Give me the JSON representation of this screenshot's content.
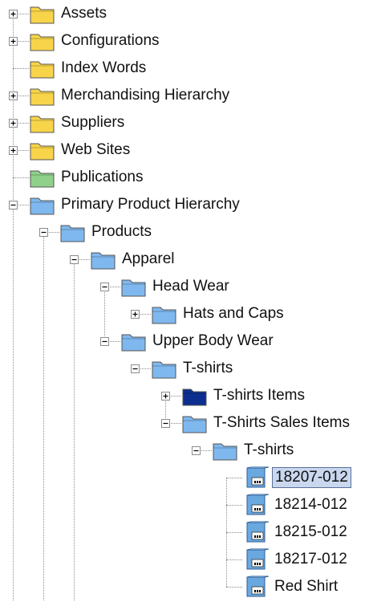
{
  "tree": {
    "nodes": [
      {
        "label": "Assets",
        "icon": "folder-yellow-icon",
        "expander": "plus"
      },
      {
        "label": "Configurations",
        "icon": "folder-yellow-icon",
        "expander": "plus"
      },
      {
        "label": "Index Words",
        "icon": "folder-yellow-icon",
        "expander": "none"
      },
      {
        "label": "Merchandising Hierarchy",
        "icon": "folder-yellow-icon",
        "expander": "plus"
      },
      {
        "label": "Suppliers",
        "icon": "folder-yellow-icon",
        "expander": "plus"
      },
      {
        "label": "Web Sites",
        "icon": "folder-yellow-icon",
        "expander": "plus"
      },
      {
        "label": "Publications",
        "icon": "folder-green-icon",
        "expander": "none"
      },
      {
        "label": "Primary Product Hierarchy",
        "icon": "folder-blue-icon",
        "expander": "minus"
      },
      {
        "label": "Products",
        "icon": "folder-blue-icon",
        "expander": "minus"
      },
      {
        "label": "Apparel",
        "icon": "folder-blue-icon",
        "expander": "minus"
      },
      {
        "label": "Head Wear",
        "icon": "folder-blue-icon",
        "expander": "minus"
      },
      {
        "label": "Hats and Caps",
        "icon": "folder-blue-icon",
        "expander": "plus"
      },
      {
        "label": "Upper Body Wear",
        "icon": "folder-blue-icon",
        "expander": "minus"
      },
      {
        "label": "T-shirts",
        "icon": "folder-blue-icon",
        "expander": "minus"
      },
      {
        "label": "T-shirts Items",
        "icon": "folder-darkblue-icon",
        "expander": "plus"
      },
      {
        "label": "T-Shirts Sales Items",
        "icon": "folder-blue-icon",
        "expander": "minus"
      },
      {
        "label": "T-shirts",
        "icon": "folder-blue-icon",
        "expander": "minus"
      },
      {
        "label": "18207-012",
        "icon": "product-icon",
        "expander": "none",
        "selected": true
      },
      {
        "label": "18214-012",
        "icon": "product-icon",
        "expander": "none"
      },
      {
        "label": "18215-012",
        "icon": "product-icon",
        "expander": "none"
      },
      {
        "label": "18217-012",
        "icon": "product-icon",
        "expander": "none"
      },
      {
        "label": "Red Shirt",
        "icon": "product-icon",
        "expander": "none"
      }
    ]
  },
  "colors": {
    "folder_yellow": "#f7d44a",
    "folder_green": "#8fd18a",
    "folder_blue": "#7fb8ee",
    "folder_darkblue": "#0c2f8f",
    "product_blue": "#6aa8e0",
    "selection_bg": "#c9d7ef",
    "selection_border": "#5b6f96"
  }
}
